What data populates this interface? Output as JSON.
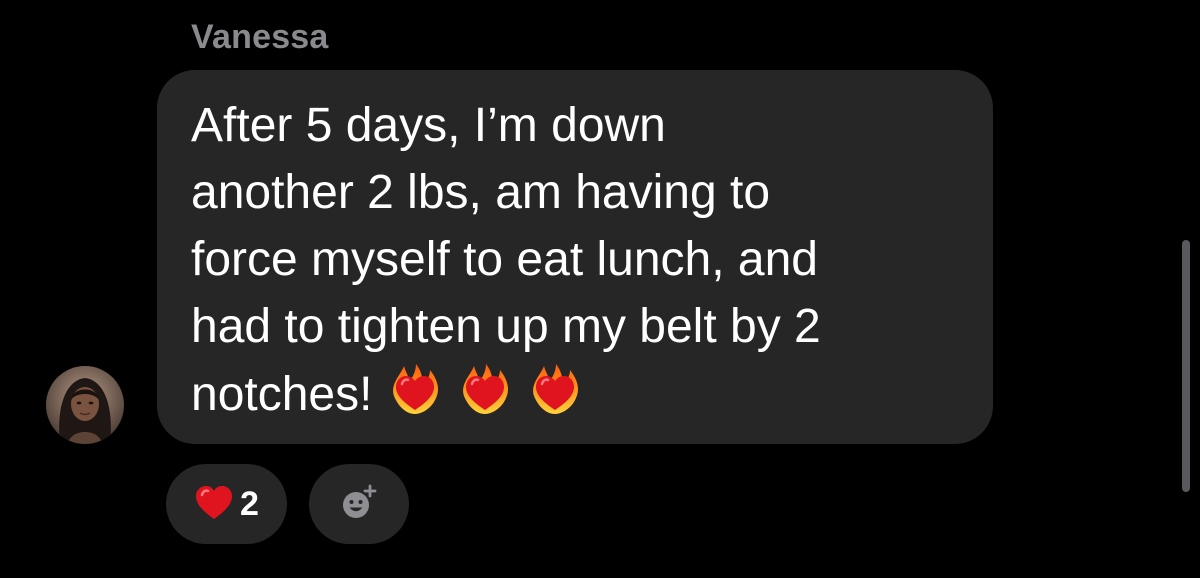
{
  "message": {
    "sender_name": "Vanessa",
    "text": "After 5 days, I’m down\nanother 2 lbs, am having to\nforce myself to eat lunch, and\nhad to tighten up my belt by 2\nnotches!",
    "trailing_emoji": [
      "heart-on-fire-icon",
      "heart-on-fire-icon",
      "heart-on-fire-icon"
    ]
  },
  "reactions": {
    "heart_emoji": "red-heart-icon",
    "count": "2",
    "add_reaction_icon": "add-emoji-icon"
  },
  "colors": {
    "background": "#000000",
    "bubble": "#262626",
    "sender_name": "#8a8a8e",
    "text": "#ffffff",
    "heart_red": "#e0141e",
    "scrollbar": "#5a5a5e"
  }
}
